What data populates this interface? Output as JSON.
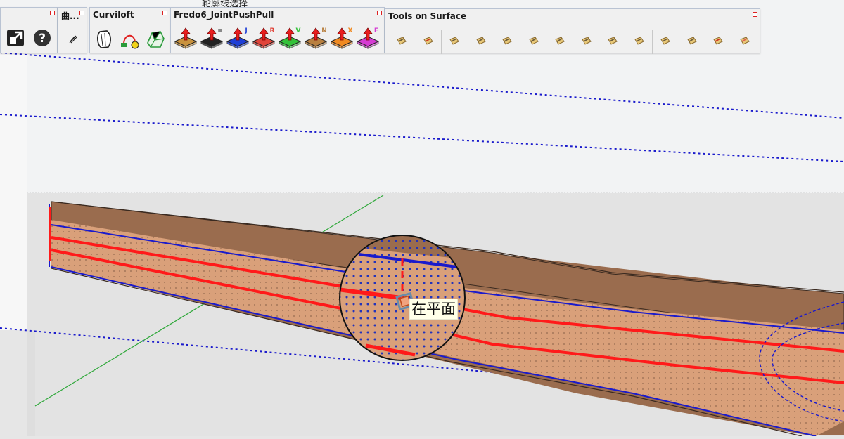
{
  "toolbars": {
    "curve_partial": {
      "title": "曲..."
    },
    "curviloft": {
      "title": "Curviloft",
      "tools": [
        "curviloft-loft-icon",
        "curviloft-skin-icon",
        "curviloft-contour-icon"
      ]
    },
    "joint_push_pull": {
      "title": "Fredo6_JointPushPull",
      "tools": [
        {
          "name": "push-pull-base",
          "letter": "",
          "color": "#c8923e"
        },
        {
          "name": "push-pull-joint",
          "letter": "=",
          "color": "#222222"
        },
        {
          "name": "push-pull-j",
          "letter": "J",
          "color": "#1f3fd6"
        },
        {
          "name": "push-pull-r",
          "letter": "R",
          "color": "#e0443a"
        },
        {
          "name": "push-pull-v",
          "letter": "V",
          "color": "#33c23a"
        },
        {
          "name": "push-pull-n",
          "letter": "N",
          "color": "#b88040"
        },
        {
          "name": "push-pull-x",
          "letter": "X",
          "color": "#f08a22"
        },
        {
          "name": "push-pull-f",
          "letter": "F",
          "color": "#d53cd3"
        }
      ]
    },
    "tools_on_surface": {
      "title": "Tools on Surface",
      "tool_count": 14
    }
  },
  "left_toolbar": {
    "tools": [
      "expand-icon",
      "help-icon"
    ]
  },
  "top_strip": {
    "text": "轮廓线选择"
  },
  "viewport": {
    "tooltip": "在平面",
    "colors": {
      "face": "#d9a07a",
      "face_top": "#9a6c4e",
      "edge_red": "#ff1a1a",
      "edge_blue": "#1a1acc",
      "axis_green": "#2fa83a",
      "sky": "#f2f3f4",
      "ground": "#e3e3e3"
    }
  }
}
